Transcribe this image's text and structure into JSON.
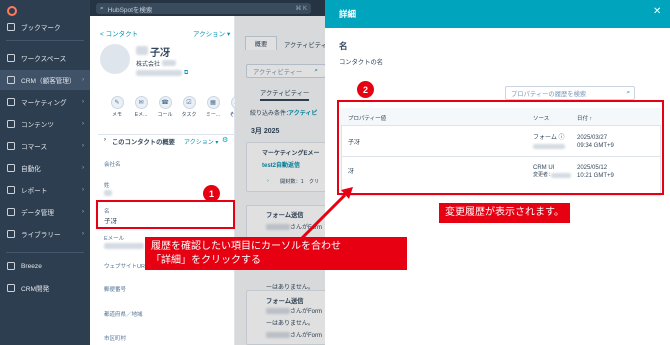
{
  "sidebar": {
    "items": [
      "ブックマーク",
      "ワークスペース",
      "CRM（顧客管理）",
      "マーケティング",
      "コンテンツ",
      "コマース",
      "自動化",
      "レポート",
      "データ管理",
      "ライブラリー",
      "Breeze",
      "CRM開発"
    ]
  },
  "topbar": {
    "search_placeholder": "HubSpotを検索",
    "shortcut": "⌘ K"
  },
  "contact": {
    "back_link": "< コンタクト",
    "actions_label": "アクション ▾",
    "name": "子冴",
    "company": "株式会社",
    "actions": [
      "メモ",
      "Eメ...",
      "コール",
      "タスク",
      "ミー...",
      "その他"
    ],
    "summary_label": "このコンタクトの概要",
    "summary_actions": "アクション ▾",
    "fields": {
      "company_name": "会社名",
      "last_name": "姓",
      "first_name": "名",
      "first_name_value": "子冴",
      "email": "Eメール",
      "website": "ウェブサイトURL",
      "zip": "郵便番号",
      "prefecture": "都道府県／地域",
      "city": "市区町村"
    }
  },
  "activity": {
    "tabs": [
      "概要",
      "アクティビティ"
    ],
    "search_placeholder": "アクティビティー",
    "sub_tab": "アクティビティー",
    "filter": "絞り込み条件：",
    "filter_link": "アクティビ",
    "month": "3月 2025",
    "card1_title": "マーケティングEメー",
    "card1_link": "test2自動返信",
    "card1_meta": "開封数：1　クリ",
    "form_title": "フォーム送信",
    "form_line1": "さんがForm",
    "form_line2": "ーはありません。"
  },
  "modal": {
    "title": "詳細",
    "section": "名",
    "subtitle": "コンタクトの名",
    "search_placeholder": "プロパティーの履歴を検索",
    "columns": [
      "プロパティー値",
      "ソース",
      "日付 ↑"
    ],
    "rows": [
      {
        "value": "子冴",
        "source": "フォーム ⓘ",
        "source2": "",
        "date": "2025/03/27",
        "time": "09:34 GMT+9"
      },
      {
        "value": "冴",
        "source": "CRM UI",
        "source2": "変更者：",
        "date": "2025/05/12",
        "time": "10:21 GMT+9"
      }
    ]
  },
  "annotations": {
    "badge1": "1",
    "badge2": "2",
    "callout1_line1": "履歴を確認したい項目にカーソルを合わせ",
    "callout1_line2": "「詳細」をクリックする",
    "callout2": "変更履歴が表示されます。"
  }
}
